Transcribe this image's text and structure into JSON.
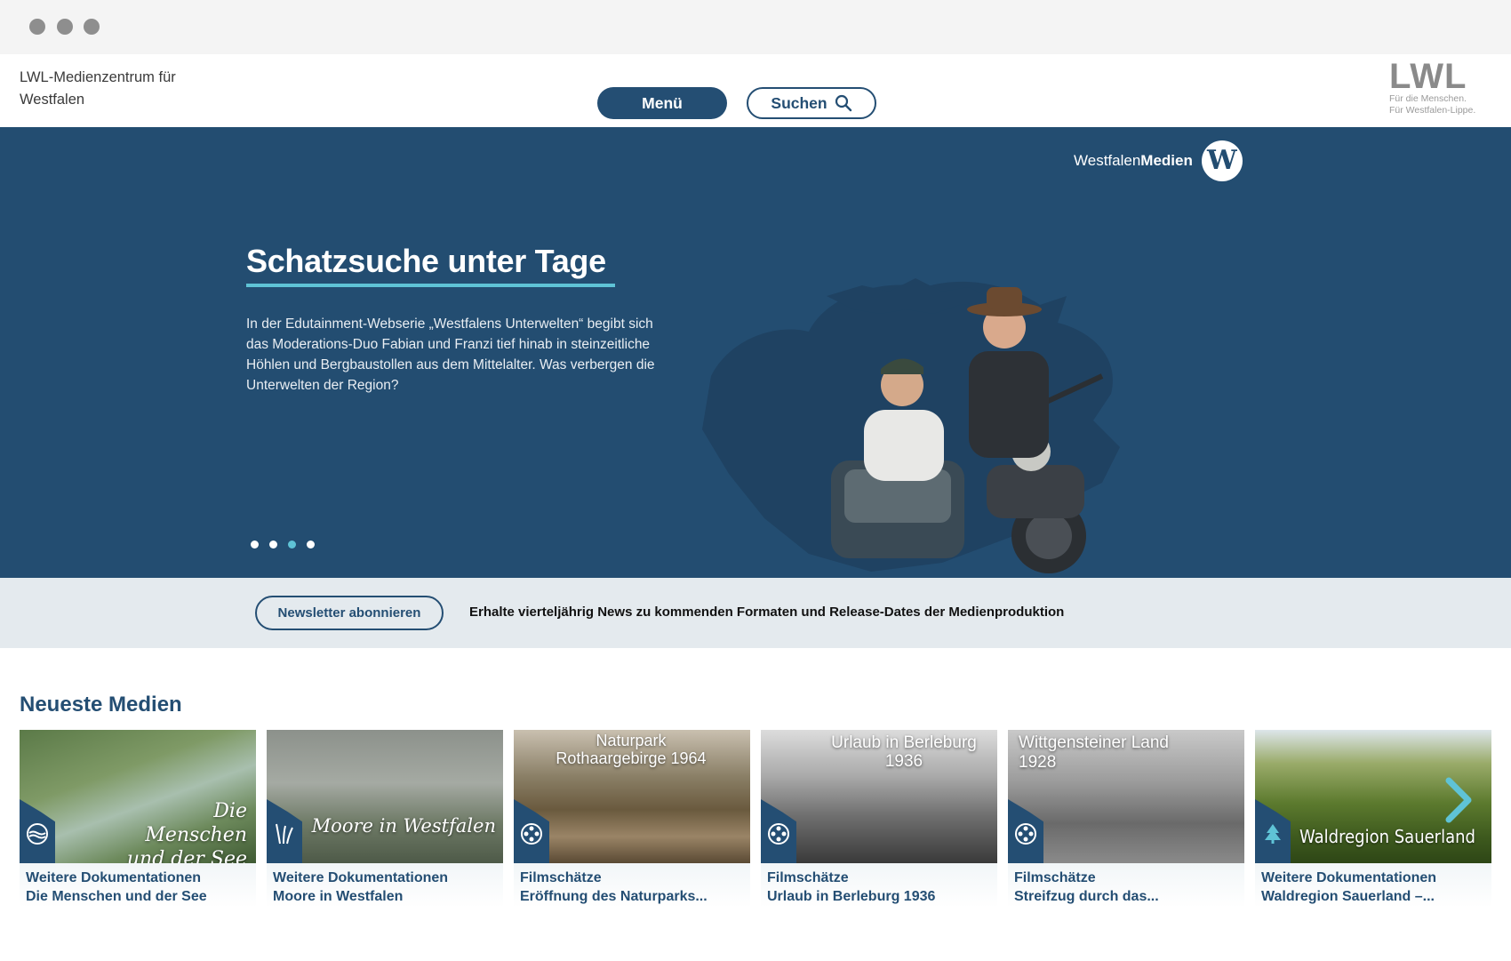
{
  "header": {
    "org_line1": "LWL-Medienzentrum für",
    "org_line2": "Westfalen",
    "menu_label": "Menü",
    "search_label": "Suchen",
    "logo_mark": "LWL",
    "logo_tag1": "Für die Menschen.",
    "logo_tag2": "Für Westfalen-Lippe."
  },
  "hero": {
    "brand_light": "Westfalen",
    "brand_bold": "Medien",
    "brand_logo_letter": "W",
    "title": "Schatzsuche unter Tage",
    "text": "In der Edutainment-Webserie „Westfalens Unterwelten“ begibt sich das Moderations-Duo Fabian und Franzi tief hinab in steinzeitliche Höhlen und Bergbaustollen aus dem Mittelalter. Was verbergen die Unterwelten der Region?",
    "slides": 4,
    "active_slide": 3
  },
  "newsletter": {
    "button": "Newsletter abonnieren",
    "text": "Erhalte vierteljährig News zu kommenden Formaten und Release-Dates der Medienproduktion"
  },
  "section_title": "Neueste Medien",
  "cards": [
    {
      "thumb_title": "Die Menschen und der See",
      "category": "Weitere Dokumentationen",
      "title": "Die Menschen und der See",
      "icon": "water-icon"
    },
    {
      "thumb_title": "Moore in Westfalen",
      "category": "Weitere Dokumentationen",
      "title": "Moore in Westfalen",
      "icon": "reed-icon"
    },
    {
      "thumb_title": "Naturpark Rothaargebirge 1964",
      "category": "Filmschätze",
      "title": "Eröffnung des Naturparks...",
      "icon": "film-reel-icon"
    },
    {
      "thumb_title": "Urlaub in Berleburg 1936",
      "category": "Filmschätze",
      "title": "Urlaub in Berleburg 1936",
      "icon": "film-reel-icon"
    },
    {
      "thumb_title": "Wittgensteiner Land 1928",
      "category": "Filmschätze",
      "title": "Streifzug durch das...",
      "icon": "film-reel-icon"
    },
    {
      "thumb_title": "Waldregion Sauerland",
      "category": "Weitere Dokumentationen",
      "title": "Waldregion Sauerland –...",
      "icon": "tree-icon"
    }
  ],
  "colors": {
    "primary": "#244e73",
    "accent": "#5fc3d6",
    "newsletter_bg": "#e4eaee"
  }
}
